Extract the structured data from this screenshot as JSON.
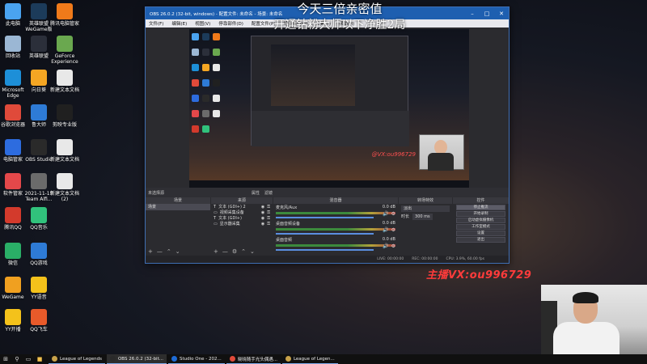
{
  "overlay": {
    "title_line1": "今天三倍亲密值",
    "title_line2": "开通钻粉大师以下净胜2局",
    "nested_caption": "开通钻粉大师以下净胜2局",
    "watermark_main": "主播VX:ou996729",
    "watermark_small": "@VX:ou996729"
  },
  "desktop_icons": [
    {
      "label": "此电脑",
      "icon": "computer-icon",
      "color": "#4aa3f0"
    },
    {
      "label": "英雄联盟\nWeGame版",
      "icon": "lol-wegame-icon",
      "color": "#1c3b5a"
    },
    {
      "label": "腾讯电脑管家",
      "icon": "tencent-manager-icon",
      "color": "#f07a1a"
    },
    {
      "label": "回收站",
      "icon": "recycle-bin-icon",
      "color": "#9bb7d4"
    },
    {
      "label": "英雄联盟",
      "icon": "lol-icon",
      "color": "#2b2f3a"
    },
    {
      "label": "GeForce\nExperience",
      "icon": "geforce-icon",
      "color": "#6aa84f"
    },
    {
      "label": "Microsoft\nEdge",
      "icon": "edge-icon",
      "color": "#1d8fd8"
    },
    {
      "label": "向日葵",
      "icon": "sunflower-icon",
      "color": "#f5a623"
    },
    {
      "label": "新建文本文档",
      "icon": "text-file-icon",
      "color": "#e8e8e8"
    },
    {
      "label": "谷歌浏览器",
      "icon": "chrome-icon",
      "color": "#e04a3a"
    },
    {
      "label": "鲁大师",
      "icon": "ludashi-icon",
      "color": "#2e7bd6"
    },
    {
      "label": "剪映专业版",
      "icon": "jianying-icon",
      "color": "#202020"
    },
    {
      "label": "电脑管家",
      "icon": "pc-manager-icon",
      "color": "#2d6cdf"
    },
    {
      "label": "OBS Studio",
      "icon": "obs-icon",
      "color": "#2a2a2a"
    },
    {
      "label": "新建文本文档",
      "icon": "text-file-icon",
      "color": "#e8e8e8"
    },
    {
      "label": "软件管家",
      "icon": "software-manager-icon",
      "color": "#e4484a"
    },
    {
      "label": "2021-11-19\nTeam Alfi...",
      "icon": "folder-icon",
      "color": "#6b6b6b"
    },
    {
      "label": "新建文本文档\n(2)",
      "icon": "text-file-icon",
      "color": "#e8e8e8"
    },
    {
      "label": "腾讯QQ",
      "icon": "qq-icon",
      "color": "#d33a2c"
    },
    {
      "label": "QQ音乐",
      "icon": "qq-music-icon",
      "color": "#31c27c"
    },
    {
      "label": "微信",
      "icon": "wechat-icon",
      "color": "#2aae67"
    },
    {
      "label": "QQ游戏",
      "icon": "qq-game-icon",
      "color": "#2e7bd6"
    },
    {
      "label": "WeGame",
      "icon": "wegame-icon",
      "color": "#f0a020"
    },
    {
      "label": "YY语音",
      "icon": "yy-voice-icon",
      "color": "#f4c21b"
    },
    {
      "label": "YY开播",
      "icon": "yy-live-icon",
      "color": "#f4c21b"
    },
    {
      "label": "QQ飞车",
      "icon": "qq-speed-icon",
      "color": "#e85a2a"
    }
  ],
  "obs": {
    "title": "OBS 26.0.2 (32-bit, windows) - 配置文件: 未命名 - 场景: 未命名",
    "menu": [
      "文件(F)",
      "编辑(E)",
      "视图(V)",
      "停靠部件(D)",
      "配置文件(P)",
      "场景集合(S)",
      "工具(T)",
      "帮助(H)"
    ],
    "scene_bar": {
      "left": "未选择源",
      "props": "属性",
      "filters": "滤镜"
    },
    "docks": {
      "scenes": {
        "header": "场景",
        "items": [
          "场景"
        ]
      },
      "sources": {
        "header": "来源",
        "items": [
          {
            "icon": "T",
            "label": "文本 (GDI+) 2"
          },
          {
            "icon": "▭",
            "label": "视频采集设备"
          },
          {
            "icon": "T",
            "label": "文本 (GDI+)"
          },
          {
            "icon": "▭",
            "label": "显示器采集"
          }
        ]
      },
      "mixer": {
        "header": "混音器",
        "channels": [
          {
            "name": "麦克风/Aux",
            "db": "0.0 dB"
          },
          {
            "name": "桌面音频设备",
            "db": "0.0 dB"
          },
          {
            "name": "桌面音频",
            "db": "0.0 dB"
          }
        ]
      },
      "transitions": {
        "header": "转场特效",
        "type": "淡出",
        "duration_label": "时长",
        "duration": "300 ms"
      },
      "controls": {
        "header": "控件",
        "buttons": [
          "停止推流",
          "开始录制",
          "启动虚拟摄像机",
          "工作室模式",
          "设置",
          "退出"
        ]
      }
    },
    "status": {
      "live": "LIVE: 00:00:00",
      "rec": "REC: 00:00:00",
      "cpu": "CPU: 3.9%, 60.00 fps"
    }
  },
  "taskbar": {
    "apps": [
      {
        "label": "League of Legends",
        "color": "#c8a24a"
      },
      {
        "label": "OBS 26.0.2 (32-bit...",
        "color": "#2a2a2a",
        "active": true
      },
      {
        "label": "Studio One - 202...",
        "color": "#1e6bd6"
      },
      {
        "label": "晓晓随手光头偶遇...",
        "color": "#e04a3a"
      },
      {
        "label": "League of Legen...",
        "color": "#c8a24a"
      }
    ]
  }
}
